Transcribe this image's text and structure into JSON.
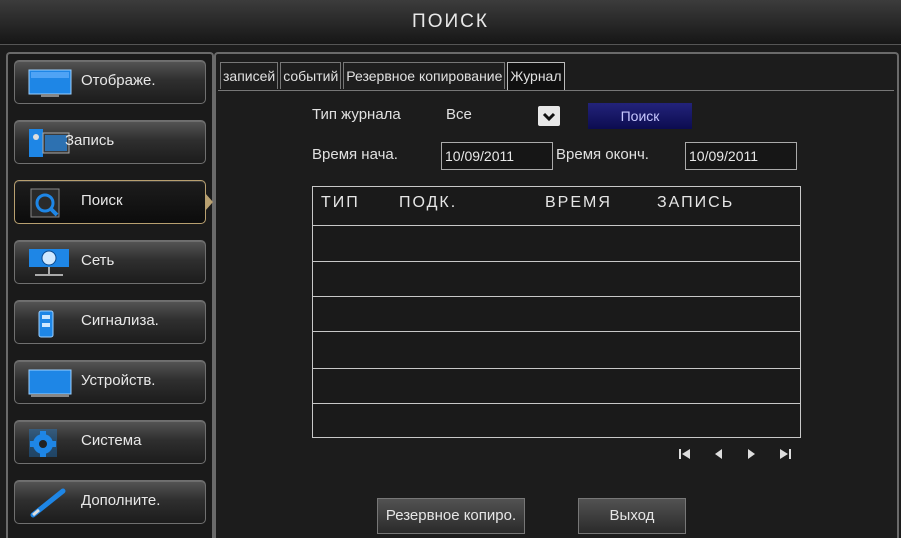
{
  "window": {
    "title": "ПОИСК"
  },
  "sidebar": {
    "items": [
      {
        "label": "Отображе.",
        "icon": "monitor-icon"
      },
      {
        "label": "Запись",
        "icon": "film-camera-icon"
      },
      {
        "label": "Поиск",
        "icon": "magnifier-icon",
        "active": true
      },
      {
        "label": "Сеть",
        "icon": "network-globe-icon"
      },
      {
        "label": "Сигнализа.",
        "icon": "alarm-icon"
      },
      {
        "label": "Устройств.",
        "icon": "device-monitor-icon"
      },
      {
        "label": "Система",
        "icon": "gear-icon"
      },
      {
        "label": "Дополните.",
        "icon": "pen-icon"
      }
    ]
  },
  "tabs": [
    {
      "label": "записей"
    },
    {
      "label": "событий"
    },
    {
      "label": "Резервное копирование"
    },
    {
      "label": "Журнал",
      "active": true
    }
  ],
  "form": {
    "log_type_label": "Тип журнала",
    "log_type_value": "Все",
    "search_button": "Поиск",
    "start_time_label": "Время нача.",
    "start_time_value": "10/09/2011",
    "end_time_label": "Время оконч.",
    "end_time_value": "10/09/2011"
  },
  "table": {
    "columns": [
      "ТИП",
      "ПОДК.",
      "ВРЕМЯ",
      "ЗАПИСЬ"
    ]
  },
  "footer": {
    "backup_button": "Резервное копиро.",
    "exit_button": "Выход"
  },
  "colors": {
    "search_button": "#15156a",
    "active_border": "#b8a070",
    "icon_blue": "#1e86e6"
  }
}
